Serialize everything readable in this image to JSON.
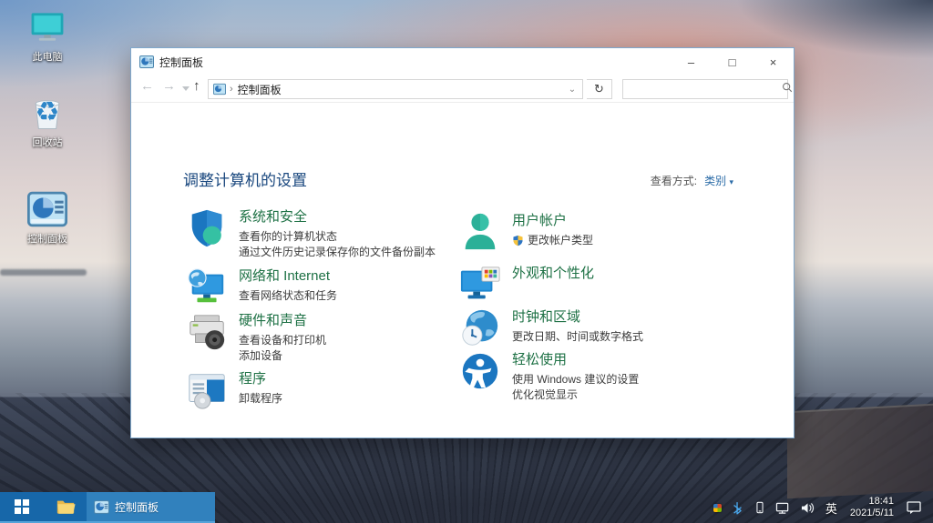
{
  "desktop": {
    "icons": [
      {
        "label": "此电脑"
      },
      {
        "label": "回收站"
      },
      {
        "label": "控制面板"
      }
    ]
  },
  "window": {
    "title": "控制面板",
    "controls": {
      "minimize": "–",
      "maximize": "□",
      "close": "×"
    },
    "toolbar": {
      "back": "←",
      "forward": "→",
      "up": "↑",
      "refresh": "↻",
      "breadcrumb_sep": "›",
      "breadcrumb": "控制面板",
      "address_caret": "⌄"
    },
    "content": {
      "heading": "调整计算机的设置",
      "view_by_label": "查看方式:",
      "view_by_value": "类别",
      "view_by_caret": "▾",
      "categories": [
        {
          "title": "系统和安全",
          "icon": "shield-icon",
          "links": [
            "查看你的计算机状态",
            "通过文件历史记录保存你的文件备份副本"
          ]
        },
        {
          "title": "网络和 Internet",
          "icon": "network-icon",
          "links": [
            "查看网络状态和任务"
          ]
        },
        {
          "title": "硬件和声音",
          "icon": "printer-icon",
          "links": [
            "查看设备和打印机",
            "添加设备"
          ]
        },
        {
          "title": "程序",
          "icon": "programs-icon",
          "links": [
            "卸载程序"
          ]
        },
        {
          "title": "用户帐户",
          "icon": "user-icon",
          "links": [
            "更改帐户类型"
          ]
        },
        {
          "title": "外观和个性化",
          "icon": "personalization-icon",
          "links": []
        },
        {
          "title": "时钟和区域",
          "icon": "clock-globe-icon",
          "links": [
            "更改日期、时间或数字格式"
          ]
        },
        {
          "title": "轻松使用",
          "icon": "ease-of-access-icon",
          "links": [
            "使用 Windows 建议的设置",
            "优化视觉显示"
          ]
        }
      ]
    }
  },
  "taskbar": {
    "task_label": "控制面板",
    "tray": {
      "input_indicator": "英",
      "time": "18:41",
      "date": "2021/5/11"
    }
  },
  "glyphs": {
    "recycle": "♻"
  },
  "colors": {
    "category_green": "#1e7145",
    "link_blue": "#2d6da8",
    "heading_navy": "#19477e",
    "taskbar_blue": "#1767a9",
    "task_active_blue": "#3181bd"
  }
}
